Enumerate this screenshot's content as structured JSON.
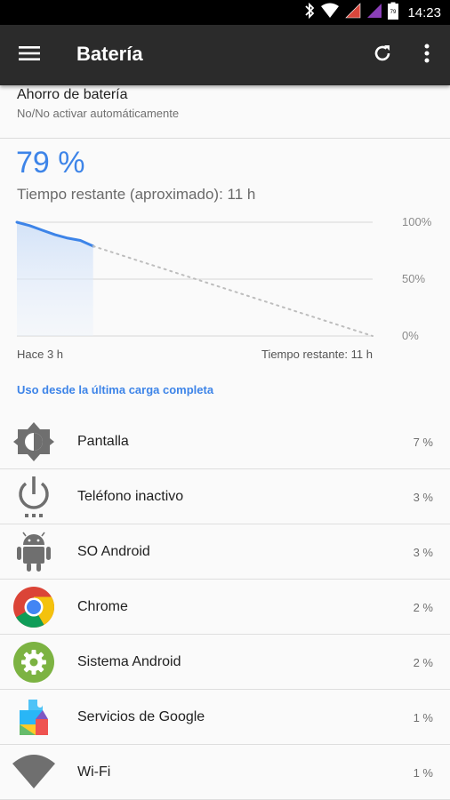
{
  "status_bar": {
    "time": "14:23",
    "battery_level": "79",
    "icons": [
      "bluetooth-icon",
      "wifi-signal-icon",
      "cell-signal-icon",
      "cell-signal-icon",
      "battery-icon"
    ]
  },
  "app_bar": {
    "title": "Batería",
    "icons": [
      "menu-icon",
      "refresh-icon",
      "more-vert-icon"
    ]
  },
  "battery_saver": {
    "title": "Ahorro de batería",
    "subtitle": "No/No activar automáticamente"
  },
  "battery": {
    "percent_text": "79 %",
    "remaining_text": "Tiempo restante (aproximado): 11 h"
  },
  "chart_data": {
    "type": "line",
    "x_labels": [
      "Hace 3 h",
      "Tiempo restante: 11 h"
    ],
    "y_ticks": [
      "100%",
      "50%",
      "0%"
    ],
    "ylim": [
      0,
      100
    ],
    "series": [
      {
        "x": [
          0,
          0.5,
          1,
          1.5,
          2,
          2.5,
          3
        ],
        "y": [
          100,
          97,
          93,
          89,
          86,
          84,
          79
        ]
      },
      {
        "x": [
          3,
          14
        ],
        "y": [
          79,
          0
        ]
      }
    ],
    "xlim": [
      0,
      14
    ],
    "accent": "#3d84e8"
  },
  "usage": {
    "link": "Uso desde la última carga completa",
    "items": [
      {
        "name": "Pantalla",
        "percent": "7 %",
        "icon": "brightness-icon"
      },
      {
        "name": "Teléfono inactivo",
        "percent": "3 %",
        "icon": "power-idle-icon"
      },
      {
        "name": "SO Android",
        "percent": "3 %",
        "icon": "android-robot-icon"
      },
      {
        "name": "Chrome",
        "percent": "2 %",
        "icon": "chrome-icon"
      },
      {
        "name": "Sistema Android",
        "percent": "2 %",
        "icon": "settings-gear-icon"
      },
      {
        "name": "Servicios de Google",
        "percent": "1 %",
        "icon": "google-play-services-icon"
      },
      {
        "name": "Wi-Fi",
        "percent": "1 %",
        "icon": "wifi-icon"
      }
    ]
  }
}
